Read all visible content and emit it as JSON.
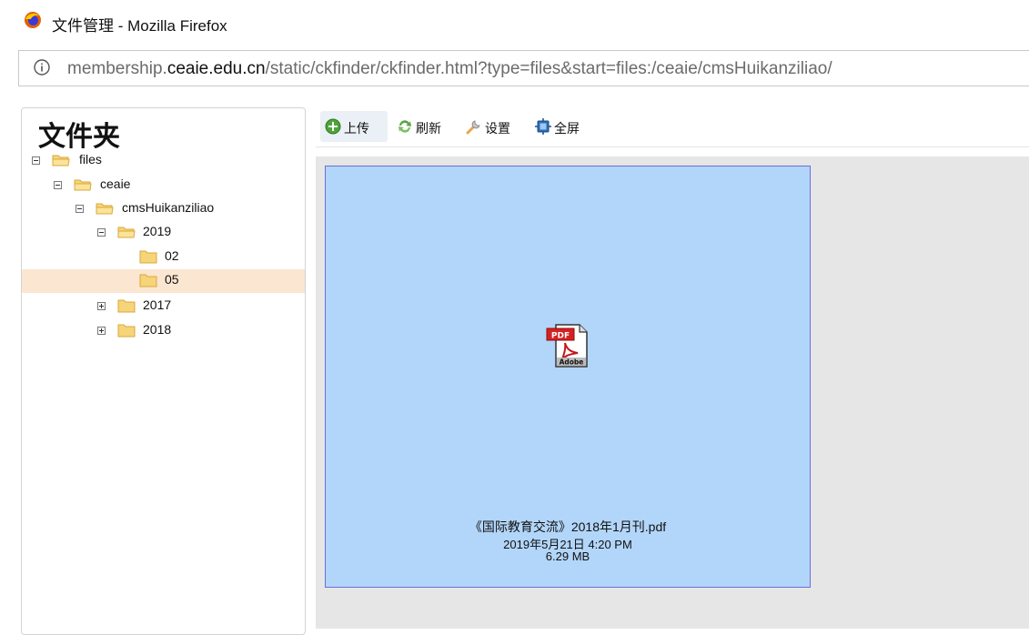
{
  "window": {
    "title": "文件管理 - Mozilla Firefox"
  },
  "address_bar": {
    "url_prefix": "membership.",
    "url_domain": "ceaie.edu.cn",
    "url_path": "/static/ckfinder/ckfinder.html?type=files&start=files:/ceaie/cmsHuikanziliao/"
  },
  "folders_panel": {
    "title": "文件夹",
    "tree": [
      {
        "label": "files",
        "toggle": "minus",
        "level": 0
      },
      {
        "label": "ceaie",
        "toggle": "minus",
        "level": 1
      },
      {
        "label": "cmsHuikanziliao",
        "toggle": "minus",
        "level": 2
      },
      {
        "label": "2019",
        "toggle": "minus",
        "level": 3
      },
      {
        "label": "02",
        "toggle": "none",
        "level": 4
      },
      {
        "label": "05",
        "toggle": "none",
        "level": 4,
        "selected": true
      },
      {
        "label": "2017",
        "toggle": "plus",
        "level": 3
      },
      {
        "label": "2018",
        "toggle": "plus",
        "level": 3
      }
    ]
  },
  "toolbar": {
    "upload": {
      "label": "上传",
      "icon": "upload-plus-icon"
    },
    "refresh": {
      "label": "刷新",
      "icon": "refresh-icon"
    },
    "settings": {
      "label": "设置",
      "icon": "wrench-icon"
    },
    "fullscreen": {
      "label": "全屏",
      "icon": "fullscreen-icon"
    }
  },
  "files": [
    {
      "name": "《国际教育交流》2018年1月刊.pdf",
      "date": "2019年5月21日 4:20 PM",
      "size": "6.29 MB",
      "icon": "pdf-adobe-icon",
      "selected": true
    }
  ],
  "colors": {
    "selected_folder_bg": "#fbe6d1",
    "selected_file_bg": "#b2d6f9",
    "selected_file_border": "#6e6ed8",
    "content_bg": "#e6e6e6"
  }
}
